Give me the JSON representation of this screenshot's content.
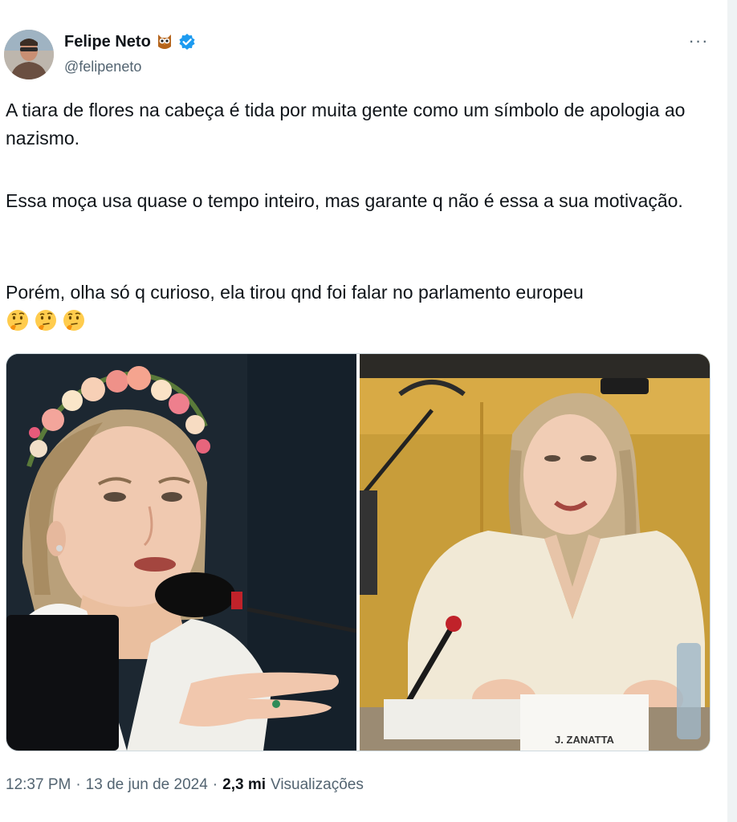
{
  "author": {
    "display_name": "Felipe Neto",
    "handle": "@felipeneto",
    "badge_icon": "owl-emoji-icon",
    "verified_icon": "verified-badge-icon",
    "verified_color": "#1d9bf0"
  },
  "actions": {
    "more_label": "···"
  },
  "tweet": {
    "paragraphs": [
      "A tiara de flores na cabeça é tida por muita gente como um símbolo de apologia ao nazismo.",
      "Essa moça usa quase o tempo inteiro, mas garante q não é essa a sua motivação.",
      "Porém, olha só q curioso, ela tirou qnd foi falar no parlamento europeu"
    ],
    "emojis": [
      "thinking-face-icon",
      "thinking-face-icon",
      "thinking-face-icon"
    ]
  },
  "media": {
    "left_photo": "woman-with-flower-crown-speaking-at-microphone",
    "right_photo": "woman-without-flower-crown-in-european-parliament",
    "nameplate": "J. ZANATTA"
  },
  "footer": {
    "time": "12:37 PM",
    "separator": "·",
    "date": "13 de jun de 2024",
    "views_count": "2,3 mi",
    "views_label": "Visualizações"
  }
}
